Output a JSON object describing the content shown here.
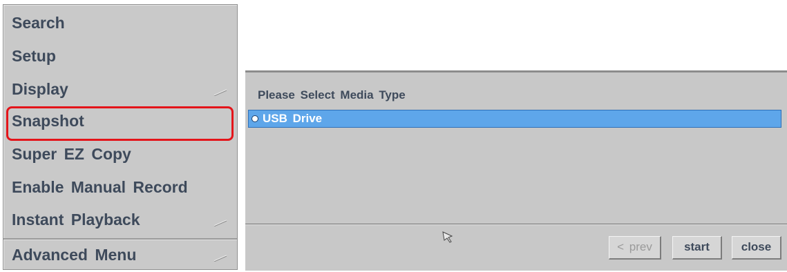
{
  "context_menu": {
    "items": [
      {
        "label": "Search",
        "has_submenu": false
      },
      {
        "label": "Setup",
        "has_submenu": false
      },
      {
        "label": "Display",
        "has_submenu": true
      },
      {
        "label": "Snapshot",
        "has_submenu": false,
        "highlighted": true
      },
      {
        "label": "Super EZ Copy",
        "has_submenu": false
      },
      {
        "label": "Enable Manual Record",
        "has_submenu": false
      },
      {
        "label": "Instant Playback",
        "has_submenu": true
      },
      {
        "label": "Advanced Menu",
        "has_submenu": true
      }
    ],
    "highlight_color": "#e4141a",
    "background": "#c9c9c9",
    "text_color": "#3e4a5b"
  },
  "dialog": {
    "title": "Please Select Media Type",
    "media_options": [
      {
        "label": "USB Drive",
        "selected": true
      }
    ],
    "buttons": {
      "prev_label": "< prev",
      "start_label": "start",
      "close_label": "close"
    },
    "selection_color": "#5ea6ea"
  }
}
